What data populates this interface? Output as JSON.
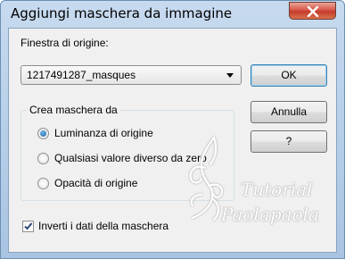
{
  "dialog": {
    "title": "Aggiungi maschera da immagine",
    "close_icon": "close-icon"
  },
  "source": {
    "label": "Finestra di origine:",
    "selected": "1217491287_masques"
  },
  "buttons": {
    "ok": "OK",
    "cancel": "Annulla",
    "help": "?"
  },
  "create_mask": {
    "group_label": "Crea maschera da",
    "options": [
      {
        "label": "Luminanza di origine",
        "checked": true
      },
      {
        "label": "Qualsiasi valore diverso da zero",
        "checked": false
      },
      {
        "label": "Opacità di origine",
        "checked": false
      }
    ]
  },
  "invert": {
    "label": "Inverti i dati della maschera",
    "checked": true
  },
  "watermark": {
    "line1": "Tutorial",
    "line2": "Paolapaola"
  },
  "colors": {
    "title_bar": "#b9d1ea",
    "close_button": "#c53b2b",
    "dialog_bg": "#f0f0f0",
    "radio_dot": "#1b5fa5"
  }
}
